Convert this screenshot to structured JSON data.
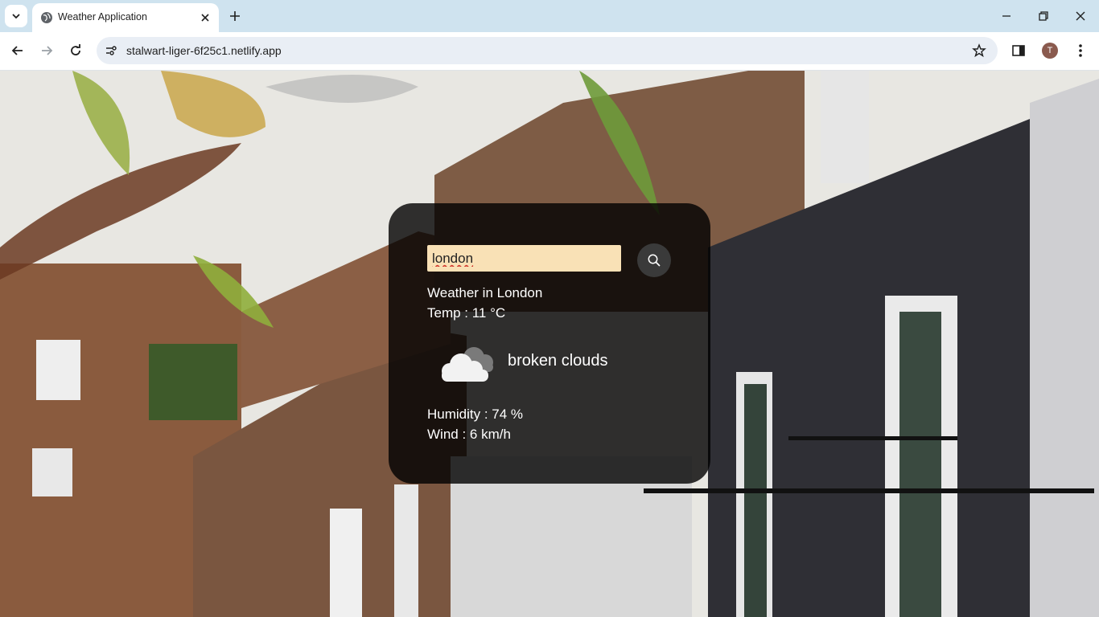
{
  "browser": {
    "tab_title": "Weather Application",
    "url": "stalwart-liger-6f25c1.netlify.app",
    "profile_initial": "T"
  },
  "weather_card": {
    "search_value": "london",
    "city_text": "Weather in London",
    "temp_text": "Temp : 11 °C",
    "description": "broken clouds",
    "humidity_text": "Humidity : 74 %",
    "wind_text": "Wind : 6 km/h",
    "icon": "broken-clouds-icon"
  },
  "colors": {
    "card_background": "#000000cc",
    "input_background": "#f9e1b6",
    "tabstrip": "#cfe3ef",
    "text": "#ffffff"
  }
}
